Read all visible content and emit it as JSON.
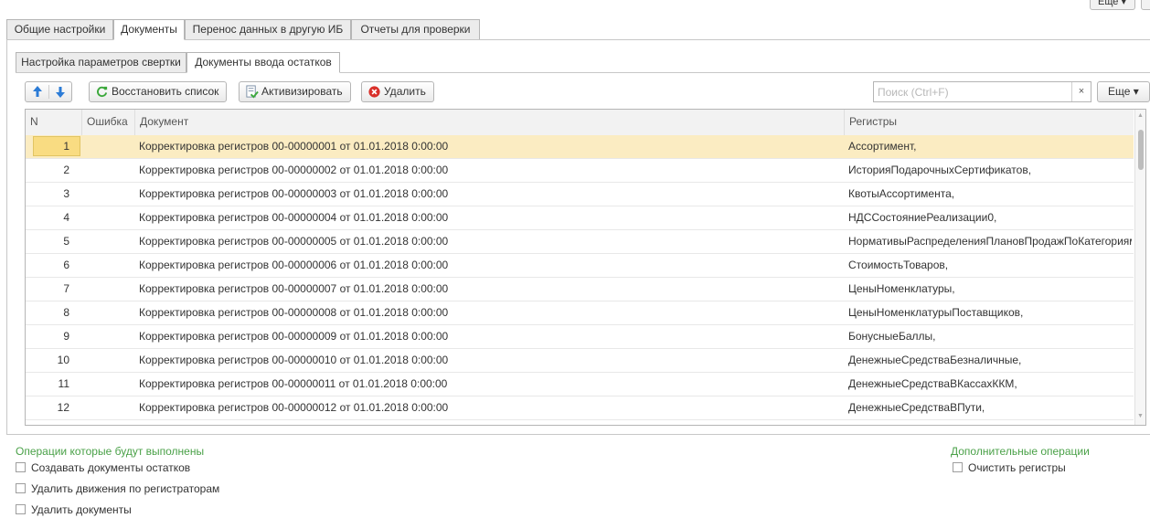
{
  "top": {
    "more_label": "Еще ▾"
  },
  "tabs": [
    {
      "label": "Общие настройки",
      "active": false
    },
    {
      "label": "Документы",
      "active": true
    },
    {
      "label": "Перенос данных в другую ИБ",
      "active": false
    },
    {
      "label": "Отчеты для проверки",
      "active": false
    }
  ],
  "subtabs": [
    {
      "label": "Настройка параметров свертки",
      "active": false
    },
    {
      "label": "Документы ввода остатков",
      "active": true
    }
  ],
  "toolbar": {
    "restore_label": "Восстановить список",
    "activate_label": "Активизировать",
    "delete_label": "Удалить",
    "search_placeholder": "Поиск (Ctrl+F)",
    "clear_label": "×",
    "more_label": "Еще ▾"
  },
  "table": {
    "columns": [
      "N",
      "Ошибка",
      "Документ",
      "Регистры"
    ],
    "rows": [
      {
        "n": "1",
        "error": "",
        "document": "Корректировка регистров 00-00000001 от 01.01.2018 0:00:00",
        "registers": "Ассортимент,"
      },
      {
        "n": "2",
        "error": "",
        "document": "Корректировка регистров 00-00000002 от 01.01.2018 0:00:00",
        "registers": "ИсторияПодарочныхСертификатов,"
      },
      {
        "n": "3",
        "error": "",
        "document": "Корректировка регистров 00-00000003 от 01.01.2018 0:00:00",
        "registers": "КвотыАссортимента,"
      },
      {
        "n": "4",
        "error": "",
        "document": "Корректировка регистров 00-00000004 от 01.01.2018 0:00:00",
        "registers": "НДССостояниеРеализации0,"
      },
      {
        "n": "5",
        "error": "",
        "document": "Корректировка регистров 00-00000005 от 01.01.2018 0:00:00",
        "registers": "НормативыРаспределенияПлановПродажПоКатегориям,"
      },
      {
        "n": "6",
        "error": "",
        "document": "Корректировка регистров 00-00000006 от 01.01.2018 0:00:00",
        "registers": "СтоимостьТоваров,"
      },
      {
        "n": "7",
        "error": "",
        "document": "Корректировка регистров 00-00000007 от 01.01.2018 0:00:00",
        "registers": "ЦеныНоменклатуры,"
      },
      {
        "n": "8",
        "error": "",
        "document": "Корректировка регистров 00-00000008 от 01.01.2018 0:00:00",
        "registers": "ЦеныНоменклатурыПоставщиков,"
      },
      {
        "n": "9",
        "error": "",
        "document": "Корректировка регистров 00-00000009 от 01.01.2018 0:00:00",
        "registers": "БонусныеБаллы,"
      },
      {
        "n": "10",
        "error": "",
        "document": "Корректировка регистров 00-00000010 от 01.01.2018 0:00:00",
        "registers": "ДенежныеСредстваБезналичные,"
      },
      {
        "n": "11",
        "error": "",
        "document": "Корректировка регистров 00-00000011 от 01.01.2018 0:00:00",
        "registers": "ДенежныеСредстваВКассахККМ,"
      },
      {
        "n": "12",
        "error": "",
        "document": "Корректировка регистров 00-00000012 от 01.01.2018 0:00:00",
        "registers": "ДенежныеСредстваВПути,"
      }
    ]
  },
  "operations": {
    "title": "Операции которые будут выполнены",
    "items": [
      {
        "label": "Создавать документы остатков",
        "checked": false
      },
      {
        "label": "Удалить движения по регистраторам",
        "checked": false
      },
      {
        "label": "Удалить документы",
        "checked": false
      }
    ]
  },
  "extra_operations": {
    "title": "Дополнительные операции",
    "items": [
      {
        "label": "Очистить регистры",
        "checked": false
      }
    ]
  },
  "colors": {
    "accent_green": "#4aa148",
    "selection": "#fbecc2",
    "up_arrow": "#2b7bd6",
    "delete_red": "#d9302a",
    "restore_green": "#3ba83b"
  }
}
